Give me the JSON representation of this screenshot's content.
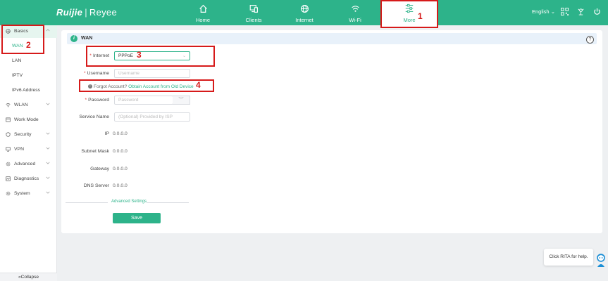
{
  "header": {
    "logo_brand": "Ruijie",
    "logo_sep": "|",
    "logo_sub": "Reyee",
    "nav": [
      {
        "label": "Home",
        "icon": "home-icon"
      },
      {
        "label": "Clients",
        "icon": "clients-icon"
      },
      {
        "label": "Internet",
        "icon": "globe-icon"
      },
      {
        "label": "Wi-Fi",
        "icon": "wifi-icon"
      },
      {
        "label": "More",
        "icon": "settings-sliders-icon"
      }
    ],
    "language": "English",
    "language_caret": "⌄",
    "icons": [
      "qr-code-icon",
      "satellite-icon",
      "power-icon"
    ]
  },
  "sidebar": {
    "groups": [
      {
        "label": "Basics",
        "icon": "globe-icon",
        "expanded": true
      },
      {
        "label": "WLAN",
        "icon": "wifi-icon"
      },
      {
        "label": "Work Mode",
        "icon": "workmode-icon"
      },
      {
        "label": "Security",
        "icon": "shield-icon"
      },
      {
        "label": "VPN",
        "icon": "monitor-icon"
      },
      {
        "label": "Advanced",
        "icon": "gear-icon"
      },
      {
        "label": "Diagnostics",
        "icon": "diagnostics-icon"
      },
      {
        "label": "System",
        "icon": "gear-icon"
      }
    ],
    "basics_items": [
      "WAN",
      "LAN",
      "IPTV",
      "IPv6 Address"
    ],
    "collapse_label": "«Collapse"
  },
  "wan": {
    "section_title": "WAN",
    "info_glyph": "i",
    "help_glyph": "?",
    "select_caret": "⌄",
    "eye_glyph": "︶",
    "required_mark": "*",
    "internet_label": "Internet",
    "internet_value": "PPPoE",
    "username_label": "Username",
    "username_placeholder": "Username",
    "forgot_glyph": "!",
    "forgot_text": "Forgot Account?",
    "forgot_link": "Obtain Account from Old Device",
    "password_label": "Password",
    "password_placeholder": "Password",
    "service_label": "Service Name",
    "service_placeholder": "(Optional) Provided by ISP",
    "ip_label": "IP",
    "ip_value": "0.0.0.0",
    "mask_label": "Subnet Mask",
    "mask_value": "0.0.0.0",
    "gateway_label": "Gateway",
    "gateway_value": "0.0.0.0",
    "dns_label": "DNS Server",
    "dns_value": "0.0.0.0",
    "advanced_label": "Advanced Settings",
    "save_label": "Save"
  },
  "annotations": [
    "1",
    "2",
    "3",
    "4"
  ],
  "rita": {
    "text": "Click RITA for help."
  },
  "colors": {
    "brand": "#2db38a",
    "annotation": "#d61a1a"
  }
}
